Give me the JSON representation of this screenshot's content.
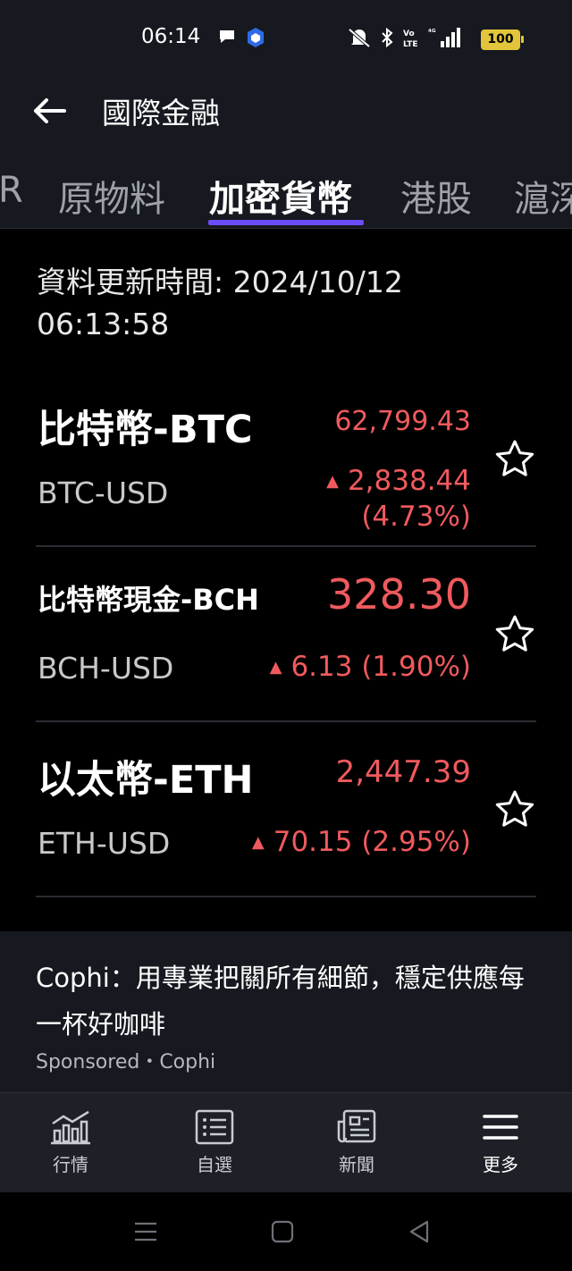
{
  "status_bar": {
    "time": "06:14",
    "left_icons": [
      "chat-bubble-icon",
      "app-shield-icon"
    ],
    "right_icons": [
      "mute-icon",
      "bluetooth-icon",
      "volte-icon",
      "signal-4g-icon"
    ],
    "battery": "100"
  },
  "header": {
    "back_icon": "arrow-left-icon",
    "title": "國際金融"
  },
  "tabs": [
    {
      "label": "R"
    },
    {
      "label": "原物料"
    },
    {
      "label": "加密貨幣",
      "active": true
    },
    {
      "label": "港股"
    },
    {
      "label": "滬深"
    }
  ],
  "update": {
    "line1": "資料更新時間: 2024/10/12",
    "line2": "06:13:58"
  },
  "quotes": [
    {
      "name": "比特幣-BTC",
      "symbol": "BTC-USD",
      "price": "62,799.43",
      "change": "2,838.44",
      "pct": "(4.73%)"
    },
    {
      "name": "比特幣現金-BCH",
      "symbol": "BCH-USD",
      "price": "328.30",
      "change": "6.13 (1.90%)"
    },
    {
      "name": "以太幣-ETH",
      "symbol": "ETH-USD",
      "price": "2,447.39",
      "change": "70.15 (2.95%)"
    }
  ],
  "ad": {
    "text": "Cophi：用專業把關所有細節，穩定供應每一杯好咖啡",
    "sponsor": "Sponsored・Cophi"
  },
  "bottom_nav": [
    {
      "label": "行情",
      "icon": "chart-icon"
    },
    {
      "label": "自選",
      "icon": "list-icon"
    },
    {
      "label": "新聞",
      "icon": "news-icon"
    },
    {
      "label": "更多",
      "icon": "menu-icon",
      "active": true
    }
  ],
  "colors": {
    "accent": "#6b4cf6",
    "up": "#f05a5e",
    "surface": "#16191f",
    "background": "#000000"
  }
}
